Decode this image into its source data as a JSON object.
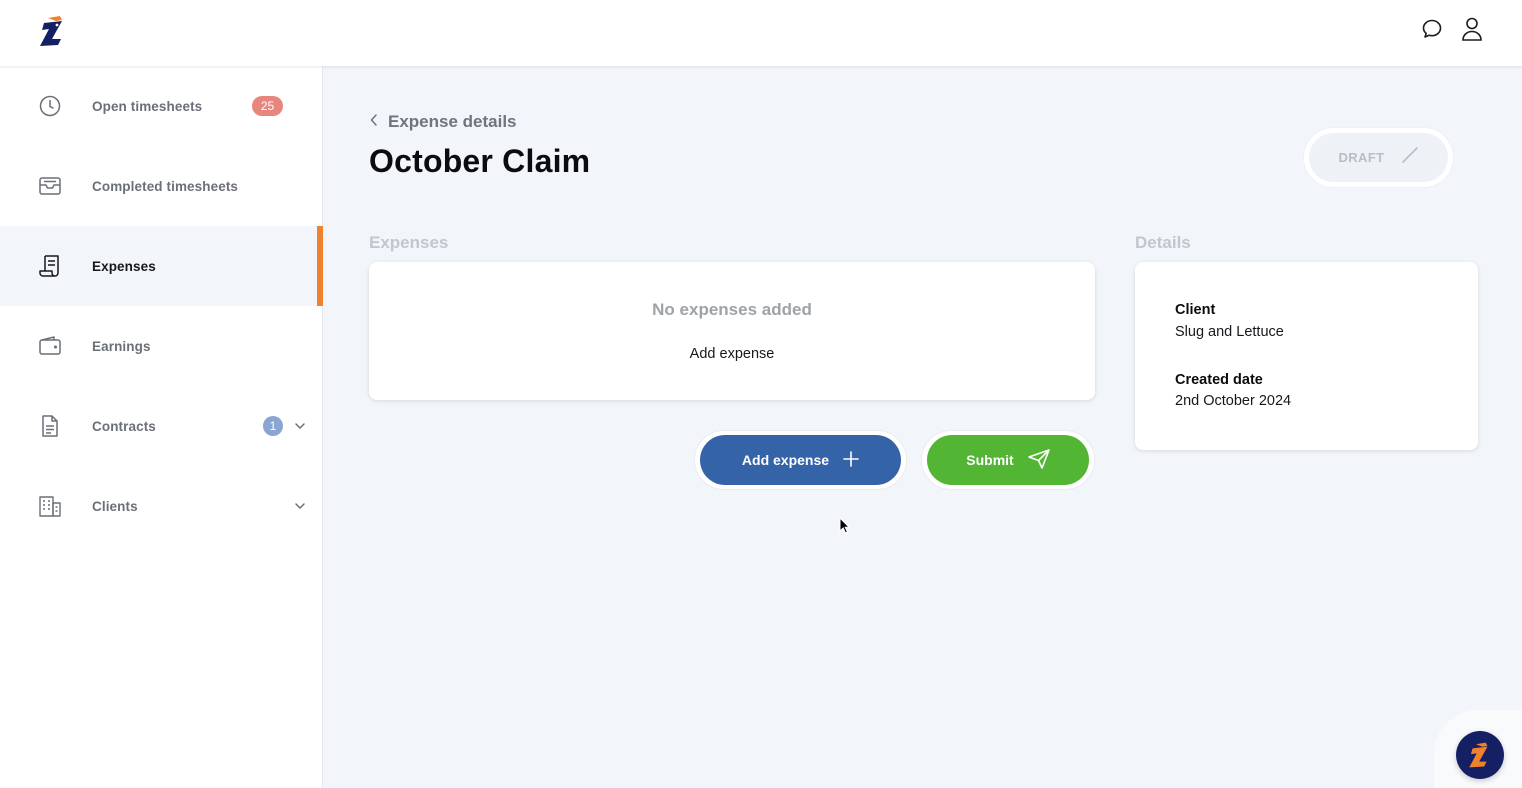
{
  "sidebar": {
    "items": [
      {
        "label": "Open timesheets",
        "badge": "25",
        "icon": "clock-icon"
      },
      {
        "label": "Completed timesheets",
        "icon": "inbox-tray-icon"
      },
      {
        "label": "Expenses",
        "icon": "receipt-icon",
        "active": true
      },
      {
        "label": "Earnings",
        "icon": "wallet-icon"
      },
      {
        "label": "Contracts",
        "badge": "1",
        "icon": "document-icon",
        "expandable": true
      },
      {
        "label": "Clients",
        "icon": "building-icon",
        "expandable": true
      }
    ]
  },
  "header": {
    "back_label": "Expense details",
    "title": "October Claim",
    "status": "DRAFT"
  },
  "expenses": {
    "section_label": "Expenses",
    "empty_title": "No expenses added",
    "empty_link": "Add expense"
  },
  "actions": {
    "add_label": "Add expense",
    "submit_label": "Submit"
  },
  "details": {
    "section_label": "Details",
    "client_label": "Client",
    "client_value": "Slug and Lettuce",
    "created_label": "Created date",
    "created_value": "2nd October 2024"
  },
  "colors": {
    "accent": "#f0822f",
    "primary_button": "#3563a8",
    "submit_button": "#53b534",
    "badge_red": "#e8857d",
    "badge_blue": "#8aa5d2",
    "brand_navy": "#152064"
  }
}
